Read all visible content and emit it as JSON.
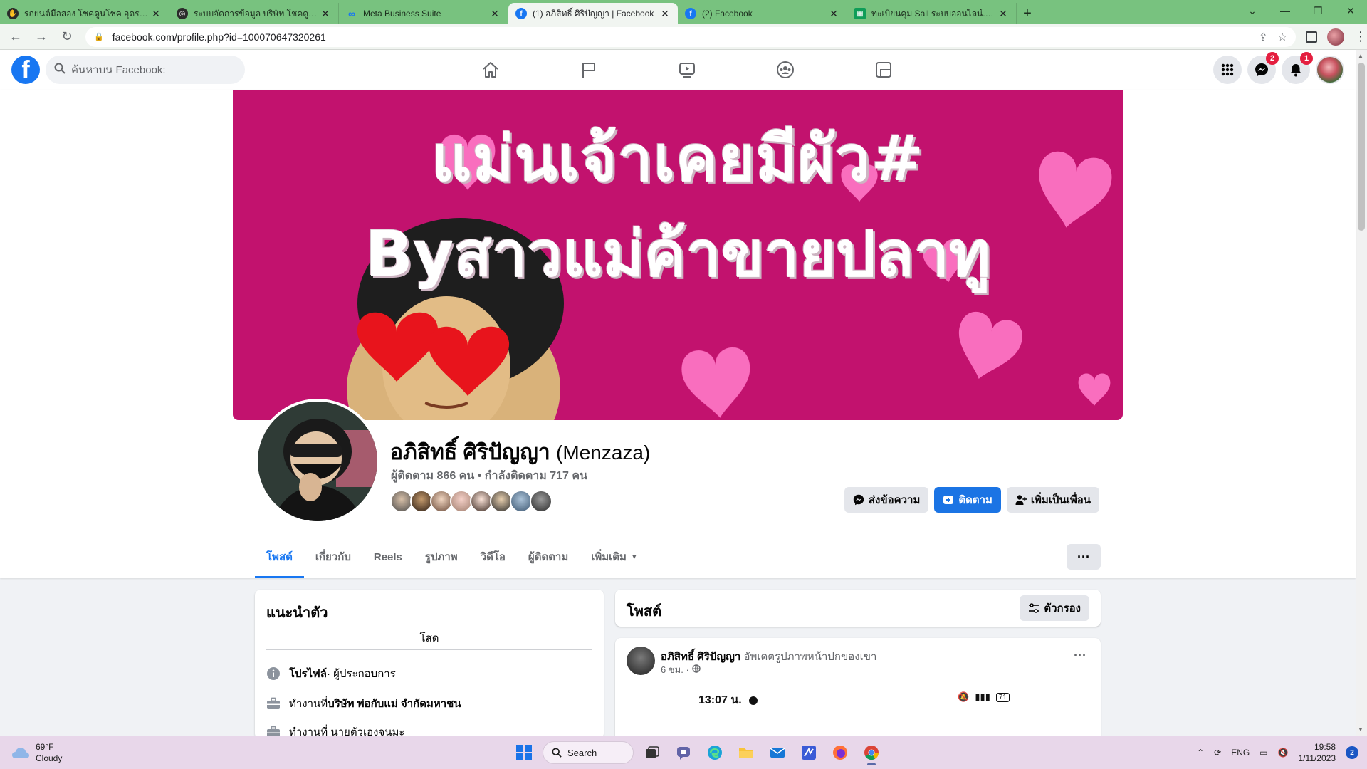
{
  "browser": {
    "tabs": [
      {
        "title": "รถยนต์มือสอง โชคดูนโชค อุดรธานี",
        "favicon_color": "#2b2b2b",
        "active": false
      },
      {
        "title": "ระบบจัดการข้อมูล บริษัท โชคดูนโชค อ",
        "favicon_color": "#2b2b2b",
        "active": false
      },
      {
        "title": "Meta Business Suite",
        "favicon_color": "#1877f2",
        "active": false
      },
      {
        "title": "(1) อภิสิทธิ์ ศิริปัญญา | Facebook",
        "favicon_color": "#1877f2",
        "active": true
      },
      {
        "title": "(2) Facebook",
        "favicon_color": "#1877f2",
        "active": false
      },
      {
        "title": "ทะเบียนคุม Sall ระบบออนไลน์.xlsx - G",
        "favicon_color": "#0f9d58",
        "active": false
      }
    ],
    "new_tab": "+",
    "url": "facebook.com/profile.php?id=100070647320261"
  },
  "fb": {
    "search_placeholder": "ค้นหาบน Facebook:",
    "messenger_badge": "2",
    "notifications_badge": "1"
  },
  "profile": {
    "cover_line1": "แม่นเจ้าเคยมีผัว#",
    "cover_line2": "Byสาวแม่ค้าขายปลาทู",
    "name": "อภิสิทธิ์ ศิริปัญญา",
    "alt_name": "(Menzaza)",
    "follow_stats": "ผู้ติดตาม 866 คน • กำลังติดตาม 717 คน",
    "buttons": {
      "message": "ส่งข้อความ",
      "follow": "ติดตาม",
      "add_friend": "เพิ่มเป็นเพื่อน"
    },
    "tabs": [
      "โพสต์",
      "เกี่ยวกับ",
      "Reels",
      "รูปภาพ",
      "วิดีโอ",
      "ผู้ติดตาม",
      "เพิ่มเติม"
    ],
    "more_options": "···"
  },
  "intro": {
    "title": "แนะนำตัว",
    "bio": "โสด",
    "profile_label": "โปรไฟล์",
    "profile_type": " · ผู้ประกอบการ",
    "work_prefix": "ทำงานที่ ",
    "work_company": "บริษัท พ่อกับแม่ จำกัดมหาชน",
    "work2": "ทำงานที่ นายตัวเองจนมะ"
  },
  "posts": {
    "title": "โพสต์",
    "filter": "ตัวกรอง",
    "post": {
      "author": "อภิสิทธิ์ ศิริปัญญา",
      "action": " อัพเดตรูปภาพหน้าปกของเขา",
      "time": "6 ชม. ·",
      "shot_time": "13:07 น.",
      "battery": "71"
    }
  },
  "taskbar": {
    "temp": "69°F",
    "condition": "Cloudy",
    "search": "Search",
    "lang": "ENG",
    "time": "19:58",
    "date": "1/11/2023",
    "notif_count": "2"
  }
}
